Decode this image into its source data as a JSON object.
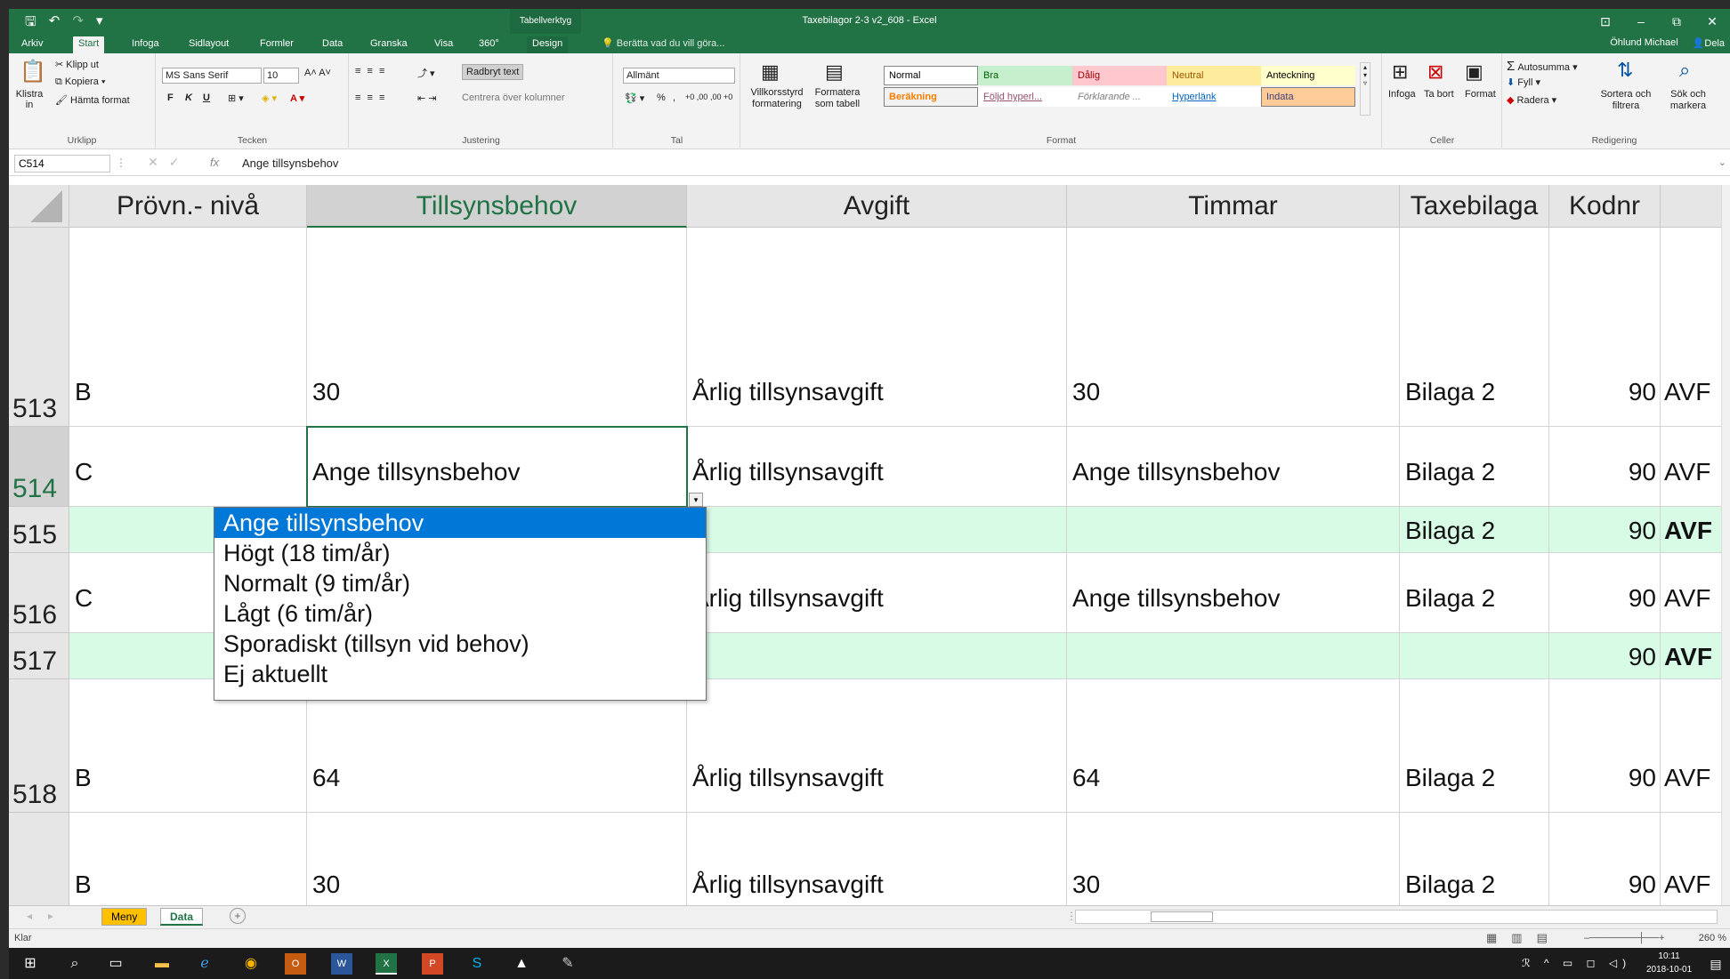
{
  "window": {
    "title": "Taxebilagor 2-3 v2_608 - Excel",
    "context_tab": "Tabellverktyg",
    "controls": [
      "⊡",
      "–",
      "⧉",
      "✕"
    ]
  },
  "quick_access": {
    "save": "🖫",
    "undo": "↶",
    "redo": "↷",
    "customize": "▾"
  },
  "tabs": [
    "Arkiv",
    "Start",
    "Infoga",
    "Sidlayout",
    "Formler",
    "Data",
    "Granska",
    "Visa",
    "360°",
    "Design"
  ],
  "active_tab": "Start",
  "tell_me": "Berätta vad du vill göra...",
  "user": "Öhlund Michael",
  "share": "Dela",
  "ribbon": {
    "clipboard": {
      "label": "Urklipp",
      "paste": "Klistra in",
      "cut": "Klipp ut",
      "copy": "Kopiera",
      "format_painter": "Hämta format"
    },
    "font": {
      "label": "Tecken",
      "font_name": "MS Sans Serif",
      "font_size": "10",
      "bold": "F",
      "italic": "K",
      "underline": "U"
    },
    "alignment": {
      "label": "Justering",
      "wrap": "Radbryt text",
      "merge": "Centrera över kolumner"
    },
    "number": {
      "label": "Tal",
      "format": "Allmänt",
      "percent": "%",
      "comma": ",",
      "inc": "+0 ,00",
      "dec": ",00 +0"
    },
    "styles": {
      "label": "Format",
      "cond": "Villkorsstyrd formatering",
      "table": "Formatera som tabell",
      "cells": [
        {
          "name": "Normal",
          "bg": "#ffffff",
          "fg": "#000000"
        },
        {
          "name": "Bra",
          "bg": "#c6efce",
          "fg": "#006100"
        },
        {
          "name": "Dålig",
          "bg": "#ffc7ce",
          "fg": "#9c0006"
        },
        {
          "name": "Neutral",
          "bg": "#ffeb9c",
          "fg": "#9c5700"
        },
        {
          "name": "Anteckning",
          "bg": "#ffffcc",
          "fg": "#000000"
        },
        {
          "name": "Beräkning",
          "bg": "#f2f2f2",
          "fg": "#fa7d00"
        },
        {
          "name": "Följd hyperl...",
          "bg": "#ffffff",
          "fg": "#954f72"
        },
        {
          "name": "Förklarande ...",
          "bg": "#ffffff",
          "fg": "#7f7f7f"
        },
        {
          "name": "Hyperlänk",
          "bg": "#ffffff",
          "fg": "#0563c1"
        },
        {
          "name": "Indata",
          "bg": "#ffcc99",
          "fg": "#3f3f76"
        }
      ]
    },
    "cells_group": {
      "label": "Celler",
      "insert": "Infoga",
      "delete": "Ta bort",
      "format": "Format"
    },
    "editing": {
      "label": "Redigering",
      "autosum": "Autosumma",
      "fill": "Fyll",
      "clear": "Radera",
      "sort": "Sortera och filtrera",
      "find": "Sök och markera"
    }
  },
  "formula_bar": {
    "name_box": "C514",
    "fx": "fx",
    "value": "Ange tillsynsbehov"
  },
  "columns": [
    "Prövn.- nivå",
    "Tillsynsbehov",
    "Avgift",
    "Timmar",
    "Taxebilaga",
    "Kodnr",
    ""
  ],
  "rows": [
    {
      "num": "513",
      "cells": [
        "B",
        "30",
        "Årlig tillsynsavgift",
        "30",
        "Bilaga 2",
        "90",
        "AVF"
      ]
    },
    {
      "num": "514",
      "cells": [
        "C",
        "Ange tillsynsbehov",
        "Årlig tillsynsavgift",
        "Ange tillsynsbehov",
        "Bilaga 2",
        "90",
        "AVF"
      ]
    },
    {
      "num": "515",
      "cells": [
        "",
        "",
        "",
        "",
        "Bilaga 2",
        "90",
        "AVF"
      ]
    },
    {
      "num": "516",
      "cells": [
        "C",
        "",
        "Årlig tillsynsavgift",
        "Ange tillsynsbehov",
        "Bilaga 2",
        "90",
        "AVF"
      ]
    },
    {
      "num": "517",
      "cells": [
        "",
        "",
        "",
        "",
        "",
        "90",
        "AVF"
      ]
    },
    {
      "num": "518",
      "cells": [
        "B",
        "64",
        "Årlig tillsynsavgift",
        "64",
        "Bilaga 2",
        "90",
        "AVF"
      ]
    },
    {
      "num": "",
      "cells": [
        "B",
        "30",
        "Årlig tillsynsavgift",
        "30",
        "Bilaga 2",
        "90",
        "AVF"
      ]
    }
  ],
  "dropdown": {
    "options": [
      "Ange tillsynsbehov",
      "Högt (18 tim/år)",
      "Normalt (9 tim/år)",
      "Lågt (6 tim/år)",
      "Sporadiskt (tillsyn vid behov)",
      "Ej aktuellt"
    ],
    "selected_index": 0
  },
  "sheets": [
    "Meny",
    "Data"
  ],
  "active_sheet": "Data",
  "status": {
    "ready": "Klar",
    "zoom": "260 %"
  },
  "taskbar": {
    "time": "10:11",
    "date": "2018-10-01"
  }
}
